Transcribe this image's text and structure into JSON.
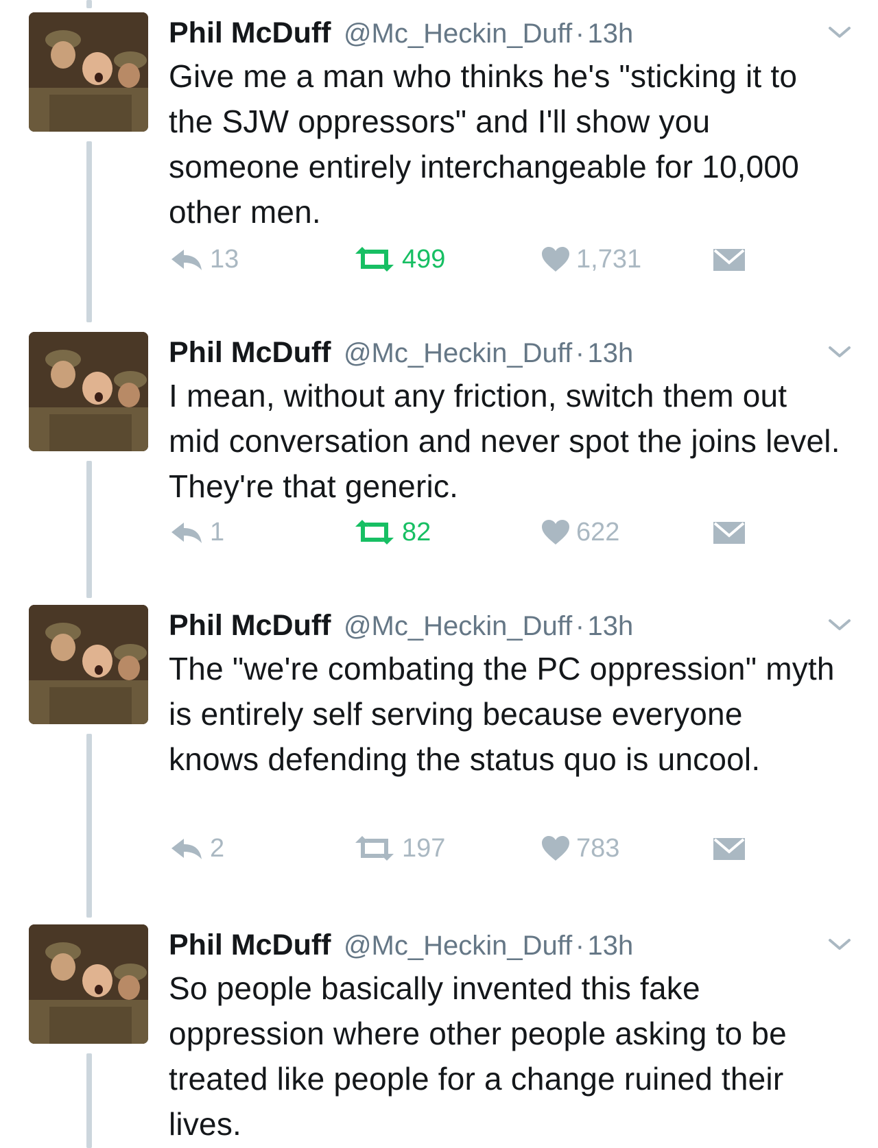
{
  "colors": {
    "name": "#14171a",
    "muted": "#657786",
    "icon_gray": "#aab8c2",
    "retweet_active": "#17bf63",
    "thread_line": "#ccd6dd"
  },
  "icons": {
    "avatar": "avatar-image",
    "chevron": "chevron-down-icon",
    "reply": "reply-icon",
    "retweet": "retweet-icon",
    "like": "heart-icon",
    "dm": "envelope-icon"
  },
  "tweets": [
    {
      "name": "Phil McDuff",
      "handle": "@Mc_Heckin_Duff",
      "separator": "·",
      "time": "13h",
      "text": "Give me a man who thinks he's \"sticking it to the SJW oppressors\" and I'll show you someone entirely interchangeable for 10,000 other men.",
      "replies": "13",
      "retweets": "499",
      "retweeted": true,
      "likes": "1,731"
    },
    {
      "name": "Phil McDuff",
      "handle": "@Mc_Heckin_Duff",
      "separator": "·",
      "time": "13h",
      "text": "I mean, without any friction, switch them out mid conversation and never spot the joins level. They're that generic.",
      "replies": "1",
      "retweets": "82",
      "retweeted": true,
      "likes": "622"
    },
    {
      "name": "Phil McDuff",
      "handle": "@Mc_Heckin_Duff",
      "separator": "·",
      "time": "13h",
      "text": "The \"we're combating the PC oppression\" myth is entirely self serving because everyone knows defending the status quo is uncool.",
      "replies": "2",
      "retweets": "197",
      "retweeted": false,
      "likes": "783"
    },
    {
      "name": "Phil McDuff",
      "handle": "@Mc_Heckin_Duff",
      "separator": "·",
      "time": "13h",
      "text": "So people basically invented this fake oppression where other people asking to be treated like people for a change ruined their lives."
    }
  ]
}
